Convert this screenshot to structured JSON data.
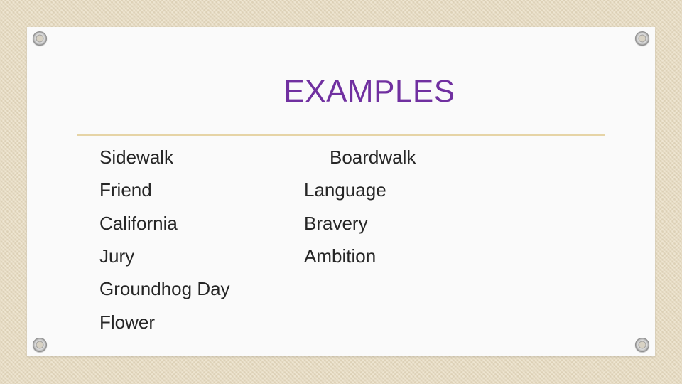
{
  "slide": {
    "title": "EXAMPLES",
    "title_color": "#7030a0",
    "accent_rule_color": "#e6d4a6",
    "left_column": [
      "Sidewalk",
      "Friend",
      "California",
      "Jury",
      "Groundhog Day",
      "Flower"
    ],
    "right_column": [
      "Boardwalk",
      "Language",
      "Bravery",
      "Ambition"
    ]
  }
}
